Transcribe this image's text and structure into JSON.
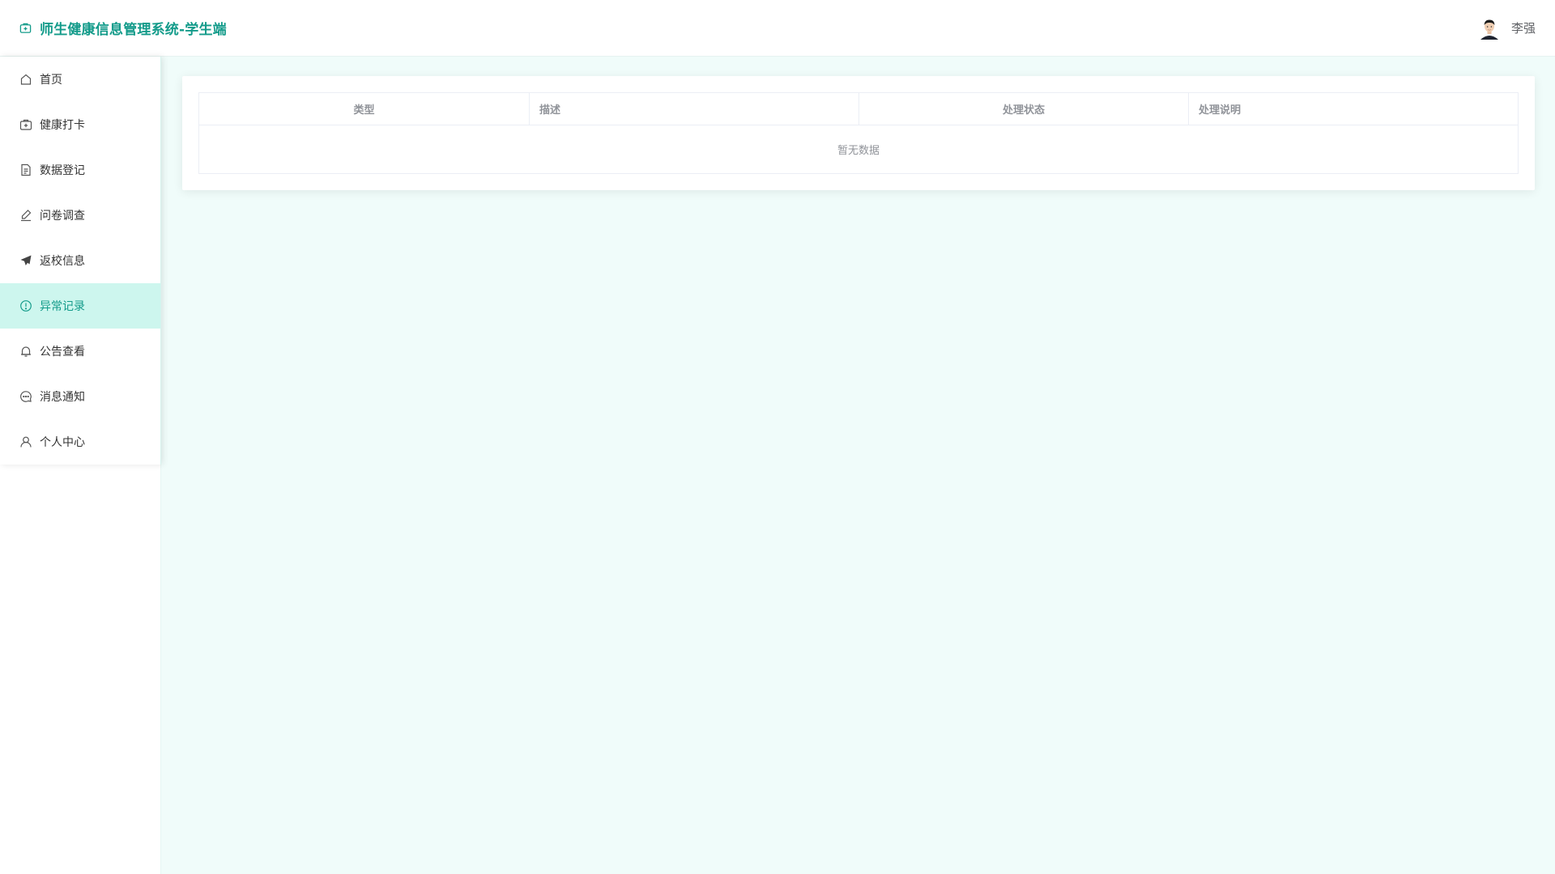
{
  "header": {
    "title": "师生健康信息管理系统-学生端",
    "username": "李强",
    "brand_icon": "medical-kit-icon",
    "accent_color": "#139b8a"
  },
  "sidebar": {
    "items": [
      {
        "label": "首页",
        "icon": "home-icon",
        "active": false
      },
      {
        "label": "健康打卡",
        "icon": "medical-kit-icon",
        "active": false
      },
      {
        "label": "数据登记",
        "icon": "document-icon",
        "active": false
      },
      {
        "label": "问卷调查",
        "icon": "edit-icon",
        "active": false
      },
      {
        "label": "返校信息",
        "icon": "send-icon",
        "active": false
      },
      {
        "label": "异常记录",
        "icon": "warning-circle-icon",
        "active": true
      },
      {
        "label": "公告查看",
        "icon": "bell-icon",
        "active": false
      },
      {
        "label": "消息通知",
        "icon": "chat-bubble-icon",
        "active": false
      },
      {
        "label": "个人中心",
        "icon": "user-icon",
        "active": false
      }
    ],
    "active_bg": "#cdf6ee"
  },
  "table": {
    "columns": [
      "类型",
      "描述",
      "处理状态",
      "处理说明"
    ],
    "rows": [],
    "empty_text": "暂无数据"
  }
}
